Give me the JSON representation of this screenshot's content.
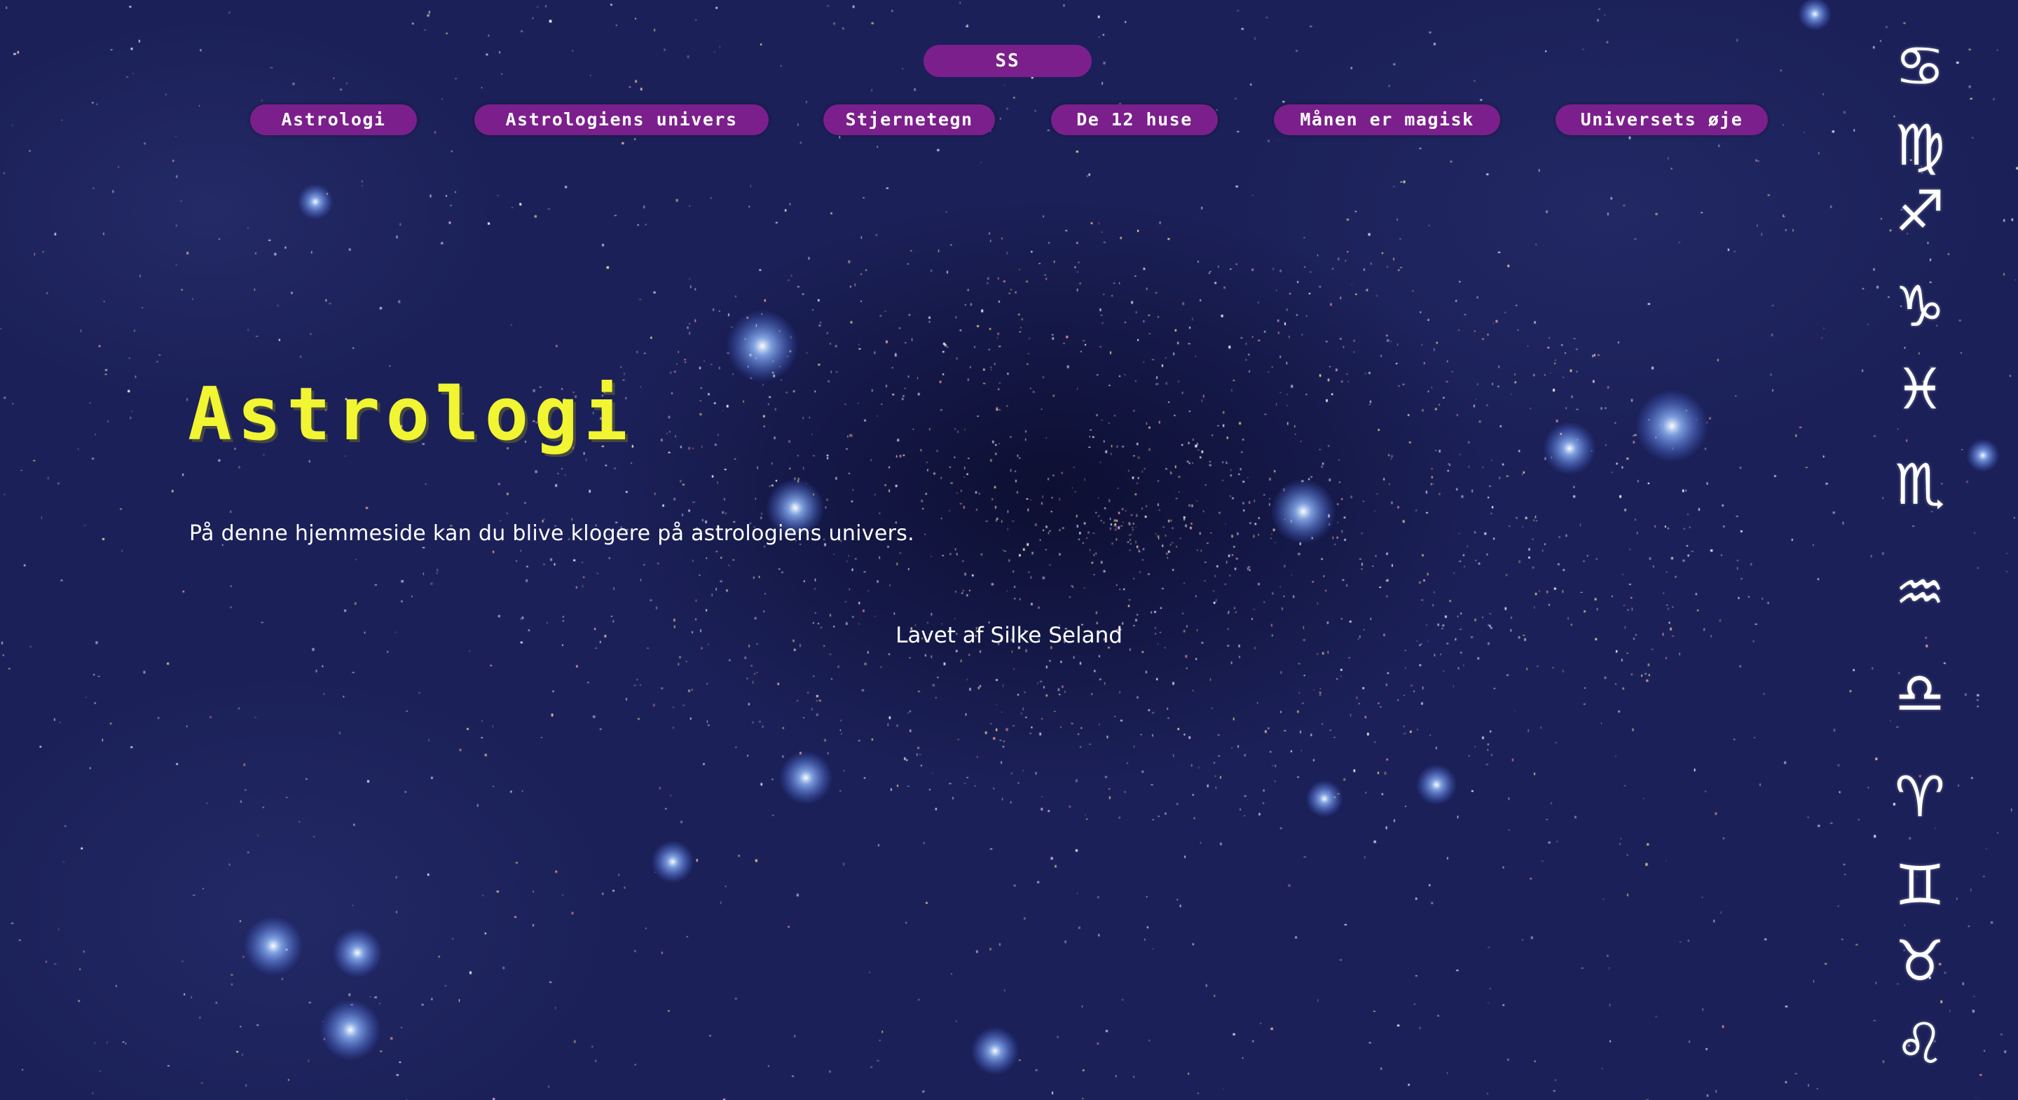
{
  "logo": {
    "label": "SS"
  },
  "nav": {
    "items": [
      {
        "label": "Astrologi"
      },
      {
        "label": "Astrologiens univers"
      },
      {
        "label": "Stjernetegn"
      },
      {
        "label": "De 12 huse"
      },
      {
        "label": "Månen er magisk"
      },
      {
        "label": "Universets øje"
      }
    ]
  },
  "main": {
    "title": "Astrologi",
    "intro": "På denne hjemmeside kan du blive klogere på astrologiens univers.",
    "credit": "Lavet af Silke Seland"
  },
  "zodiac": {
    "icons": [
      {
        "name": "cancer-icon",
        "glyph": "♋"
      },
      {
        "name": "virgo-icon",
        "glyph": "♍"
      },
      {
        "name": "sagittarius-icon",
        "glyph": "♐"
      },
      {
        "name": "capricorn-icon",
        "glyph": "♑"
      },
      {
        "name": "pisces-icon",
        "glyph": "♓"
      },
      {
        "name": "scorpio-icon",
        "glyph": "♏"
      },
      {
        "name": "aquarius-icon",
        "glyph": "♒"
      },
      {
        "name": "libra-icon",
        "glyph": "♎"
      },
      {
        "name": "aries-icon",
        "glyph": "♈"
      },
      {
        "name": "gemini-icon",
        "glyph": "♊"
      },
      {
        "name": "taurus-icon",
        "glyph": "♉"
      },
      {
        "name": "leo-icon",
        "glyph": "♌"
      }
    ]
  },
  "colors": {
    "background": "#1b2058",
    "button": "#7b1f8c",
    "title": "#f2f532",
    "text": "#ffffff"
  }
}
